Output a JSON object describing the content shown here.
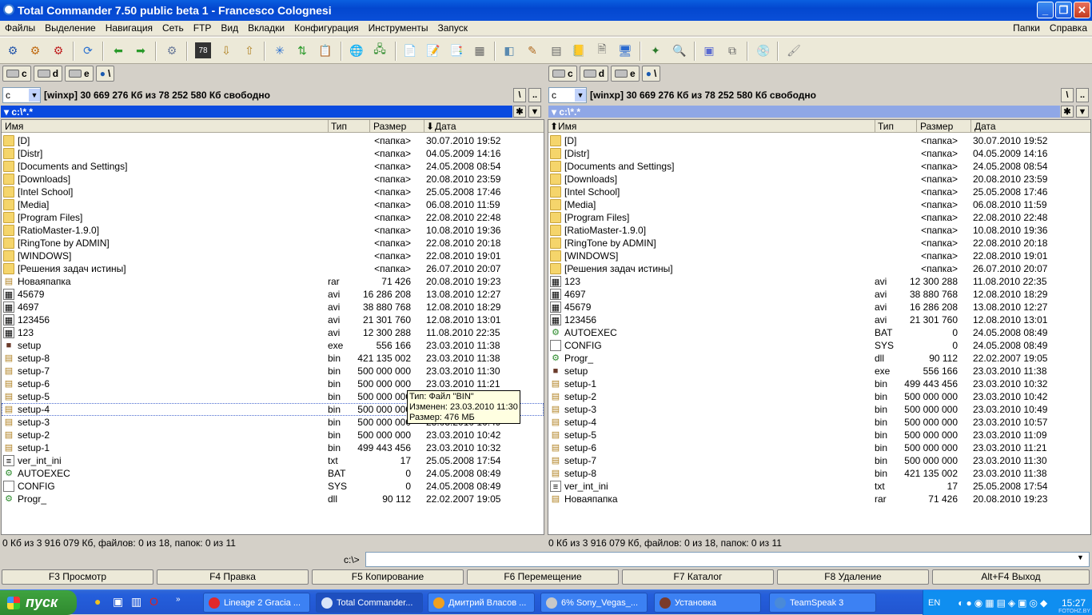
{
  "window": {
    "title": "Total Commander 7.50 public beta 1 - Francesco Colognesi"
  },
  "menu": {
    "left": [
      "Файлы",
      "Выделение",
      "Навигация",
      "Сеть",
      "FTP",
      "Вид",
      "Вкладки",
      "Конфигурация",
      "Инструменты",
      "Запуск"
    ],
    "right": [
      "Папки",
      "Справка"
    ]
  },
  "drives": [
    "c",
    "d",
    "e",
    "\\"
  ],
  "left_panel": {
    "drive": "c",
    "info": "[winxp]  30 669 276 Кб из 78 252 580 Кб свободно",
    "path": "c:\\*.*",
    "columns": {
      "name": "Имя",
      "type": "Тип",
      "size": "Размер",
      "date": "Дата"
    },
    "sort_marker": "⬇",
    "status": "0 Кб из 3 916 079 Кб, файлов: 0 из 18, папок: 0 из 11",
    "rows": [
      {
        "name": "[D]",
        "type": "",
        "size": "<папка>",
        "date": "30.07.2010 19:52",
        "icon": "folder"
      },
      {
        "name": "[Distr]",
        "type": "",
        "size": "<папка>",
        "date": "04.05.2009 14:16",
        "icon": "folder"
      },
      {
        "name": "[Documents and Settings]",
        "type": "",
        "size": "<папка>",
        "date": "24.05.2008 08:54",
        "icon": "folder"
      },
      {
        "name": "[Downloads]",
        "type": "",
        "size": "<папка>",
        "date": "20.08.2010 23:59",
        "icon": "folder"
      },
      {
        "name": "[Intel School]",
        "type": "",
        "size": "<папка>",
        "date": "25.05.2008 17:46",
        "icon": "folder"
      },
      {
        "name": "[Media]",
        "type": "",
        "size": "<папка>",
        "date": "06.08.2010 11:59",
        "icon": "folder"
      },
      {
        "name": "[Program Files]",
        "type": "",
        "size": "<папка>",
        "date": "22.08.2010 22:48",
        "icon": "folder"
      },
      {
        "name": "[RatioMaster-1.9.0]",
        "type": "",
        "size": "<папка>",
        "date": "10.08.2010 19:36",
        "icon": "folder"
      },
      {
        "name": "[RingTone by ADMIN]",
        "type": "",
        "size": "<папка>",
        "date": "22.08.2010 20:18",
        "icon": "folder"
      },
      {
        "name": "[WINDOWS]",
        "type": "",
        "size": "<папка>",
        "date": "22.08.2010 19:01",
        "icon": "folder"
      },
      {
        "name": "[Решения задач истины]",
        "type": "",
        "size": "<папка>",
        "date": "26.07.2010 20:07",
        "icon": "folder"
      },
      {
        "name": "Новаяпапка",
        "type": "rar",
        "size": "71 426",
        "date": "20.08.2010 19:23",
        "icon": "archive"
      },
      {
        "name": "45679",
        "type": "avi",
        "size": "16 286 208",
        "date": "13.08.2010 12:27",
        "icon": "video"
      },
      {
        "name": "4697",
        "type": "avi",
        "size": "38 880 768",
        "date": "12.08.2010 18:29",
        "icon": "video"
      },
      {
        "name": "123456",
        "type": "avi",
        "size": "21 301 760",
        "date": "12.08.2010 13:01",
        "icon": "video"
      },
      {
        "name": "123",
        "type": "avi",
        "size": "12 300 288",
        "date": "11.08.2010 22:35",
        "icon": "video"
      },
      {
        "name": "setup",
        "type": "exe",
        "size": "556 166",
        "date": "23.03.2010 11:38",
        "icon": "exe"
      },
      {
        "name": "setup-8",
        "type": "bin",
        "size": "421 135 002",
        "date": "23.03.2010 11:38",
        "icon": "archive"
      },
      {
        "name": "setup-7",
        "type": "bin",
        "size": "500 000 000",
        "date": "23.03.2010 11:30",
        "icon": "archive"
      },
      {
        "name": "setup-6",
        "type": "bin",
        "size": "500 000 000",
        "date": "23.03.2010 11:21",
        "icon": "archive"
      },
      {
        "name": "setup-5",
        "type": "bin",
        "size": "500 000 000",
        "date": "23.03.2010 11:09",
        "icon": "archive"
      },
      {
        "name": "setup-4",
        "type": "bin",
        "size": "500 000 000",
        "date": "23.03.2010 10:57",
        "icon": "archive"
      },
      {
        "name": "setup-3",
        "type": "bin",
        "size": "500 000 000",
        "date": "23.03.2010 10:49",
        "icon": "archive"
      },
      {
        "name": "setup-2",
        "type": "bin",
        "size": "500 000 000",
        "date": "23.03.2010 10:42",
        "icon": "archive"
      },
      {
        "name": "setup-1",
        "type": "bin",
        "size": "499 443 456",
        "date": "23.03.2010 10:32",
        "icon": "archive"
      },
      {
        "name": "ver_int_ini",
        "type": "txt",
        "size": "17",
        "date": "25.05.2008 17:54",
        "icon": "text"
      },
      {
        "name": "AUTOEXEC",
        "type": "BAT",
        "size": "0",
        "date": "24.05.2008 08:49",
        "icon": "bat"
      },
      {
        "name": "CONFIG",
        "type": "SYS",
        "size": "0",
        "date": "24.05.2008 08:49",
        "icon": "blank"
      },
      {
        "name": "Progr_",
        "type": "dll",
        "size": "90 112",
        "date": "22.02.2007 19:05",
        "icon": "bat"
      }
    ]
  },
  "right_panel": {
    "drive": "c",
    "info": "[winxp]  30 669 276 Кб из 78 252 580 Кб свободно",
    "path": "c:\\*.*",
    "columns": {
      "name": "Имя",
      "type": "Тип",
      "size": "Размер",
      "date": "Дата"
    },
    "sort_marker": "⬆",
    "status": "0 Кб из 3 916 079 Кб, файлов: 0 из 18, папок: 0 из 11",
    "rows": [
      {
        "name": "[D]",
        "type": "",
        "size": "<папка>",
        "date": "30.07.2010 19:52",
        "icon": "folder"
      },
      {
        "name": "[Distr]",
        "type": "",
        "size": "<папка>",
        "date": "04.05.2009 14:16",
        "icon": "folder"
      },
      {
        "name": "[Documents and Settings]",
        "type": "",
        "size": "<папка>",
        "date": "24.05.2008 08:54",
        "icon": "folder"
      },
      {
        "name": "[Downloads]",
        "type": "",
        "size": "<папка>",
        "date": "20.08.2010 23:59",
        "icon": "folder"
      },
      {
        "name": "[Intel School]",
        "type": "",
        "size": "<папка>",
        "date": "25.05.2008 17:46",
        "icon": "folder"
      },
      {
        "name": "[Media]",
        "type": "",
        "size": "<папка>",
        "date": "06.08.2010 11:59",
        "icon": "folder"
      },
      {
        "name": "[Program Files]",
        "type": "",
        "size": "<папка>",
        "date": "22.08.2010 22:48",
        "icon": "folder"
      },
      {
        "name": "[RatioMaster-1.9.0]",
        "type": "",
        "size": "<папка>",
        "date": "10.08.2010 19:36",
        "icon": "folder"
      },
      {
        "name": "[RingTone by ADMIN]",
        "type": "",
        "size": "<папка>",
        "date": "22.08.2010 20:18",
        "icon": "folder"
      },
      {
        "name": "[WINDOWS]",
        "type": "",
        "size": "<папка>",
        "date": "22.08.2010 19:01",
        "icon": "folder"
      },
      {
        "name": "[Решения задач истины]",
        "type": "",
        "size": "<папка>",
        "date": "26.07.2010 20:07",
        "icon": "folder"
      },
      {
        "name": "123",
        "type": "avi",
        "size": "12 300 288",
        "date": "11.08.2010 22:35",
        "icon": "video"
      },
      {
        "name": "4697",
        "type": "avi",
        "size": "38 880 768",
        "date": "12.08.2010 18:29",
        "icon": "video"
      },
      {
        "name": "45679",
        "type": "avi",
        "size": "16 286 208",
        "date": "13.08.2010 12:27",
        "icon": "video"
      },
      {
        "name": "123456",
        "type": "avi",
        "size": "21 301 760",
        "date": "12.08.2010 13:01",
        "icon": "video"
      },
      {
        "name": "AUTOEXEC",
        "type": "BAT",
        "size": "0",
        "date": "24.05.2008 08:49",
        "icon": "bat"
      },
      {
        "name": "CONFIG",
        "type": "SYS",
        "size": "0",
        "date": "24.05.2008 08:49",
        "icon": "blank"
      },
      {
        "name": "Progr_",
        "type": "dll",
        "size": "90 112",
        "date": "22.02.2007 19:05",
        "icon": "bat"
      },
      {
        "name": "setup",
        "type": "exe",
        "size": "556 166",
        "date": "23.03.2010 11:38",
        "icon": "exe"
      },
      {
        "name": "setup-1",
        "type": "bin",
        "size": "499 443 456",
        "date": "23.03.2010 10:32",
        "icon": "archive"
      },
      {
        "name": "setup-2",
        "type": "bin",
        "size": "500 000 000",
        "date": "23.03.2010 10:42",
        "icon": "archive"
      },
      {
        "name": "setup-3",
        "type": "bin",
        "size": "500 000 000",
        "date": "23.03.2010 10:49",
        "icon": "archive"
      },
      {
        "name": "setup-4",
        "type": "bin",
        "size": "500 000 000",
        "date": "23.03.2010 10:57",
        "icon": "archive"
      },
      {
        "name": "setup-5",
        "type": "bin",
        "size": "500 000 000",
        "date": "23.03.2010 11:09",
        "icon": "archive"
      },
      {
        "name": "setup-6",
        "type": "bin",
        "size": "500 000 000",
        "date": "23.03.2010 11:21",
        "icon": "archive"
      },
      {
        "name": "setup-7",
        "type": "bin",
        "size": "500 000 000",
        "date": "23.03.2010 11:30",
        "icon": "archive"
      },
      {
        "name": "setup-8",
        "type": "bin",
        "size": "421 135 002",
        "date": "23.03.2010 11:38",
        "icon": "archive"
      },
      {
        "name": "ver_int_ini",
        "type": "txt",
        "size": "17",
        "date": "25.05.2008 17:54",
        "icon": "text"
      },
      {
        "name": "Новаяпапка",
        "type": "rar",
        "size": "71 426",
        "date": "20.08.2010 19:23",
        "icon": "archive"
      }
    ]
  },
  "tooltip": {
    "line1": "Тип: Файл \"BIN\"",
    "line2": "Изменен: 23.03.2010 11:30",
    "line3": "Размер: 476 МБ"
  },
  "command_line": {
    "prompt": "c:\\>",
    "value": ""
  },
  "fkeys": [
    "F3 Просмотр",
    "F4 Правка",
    "F5 Копирование",
    "F6 Перемещение",
    "F7 Каталог",
    "F8 Удаление",
    "Alt+F4 Выход"
  ],
  "taskbar": {
    "start_label": "пуск",
    "tasks": [
      {
        "label": "Lineage 2 Gracia ...",
        "icon_color": "#e0282c"
      },
      {
        "label": "Total Commander...",
        "icon_color": "#d8e4f8"
      },
      {
        "label": "Дмитрий Власов ...",
        "icon_color": "#f0a020"
      },
      {
        "label": "6% Sony_Vegas_...",
        "icon_color": "#c8c8c8"
      },
      {
        "label": "Установка",
        "icon_color": "#7a3a2a"
      },
      {
        "label": "TeamSpeak 3",
        "icon_color": "#4a8ad8"
      }
    ],
    "lang": "EN",
    "clock": "15:27",
    "watermark": "FOTOHZ.BY"
  },
  "colors": {
    "active_path": "#0a4ae0",
    "inactive_path": "#8fa7e6",
    "title": "#0347cf"
  }
}
